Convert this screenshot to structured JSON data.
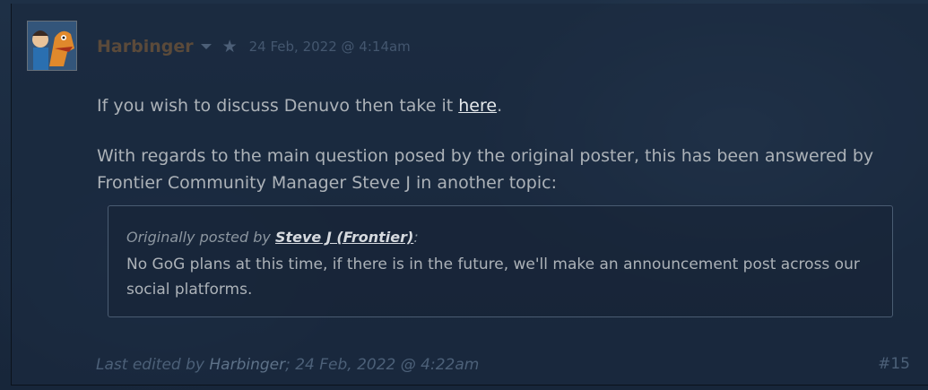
{
  "post": {
    "author": "Harbinger",
    "timestamp": "24 Feb, 2022 @ 4:14am",
    "paragraph1_prefix": "If you wish to discuss Denuvo then take it ",
    "paragraph1_link": "here",
    "paragraph1_suffix": ".",
    "paragraph2": "With regards to the main question posed by the original poster, this has been answered by Frontier Community Manager Steve J in another topic:",
    "quote": {
      "prefix": "Originally posted by ",
      "author": "Steve J (Frontier)",
      "suffix": ":",
      "text": "No GoG plans at this time, if there is in the future, we'll make an announcement post across our social platforms."
    },
    "edited_prefix": "Last edited by ",
    "edited_by": "Harbinger",
    "edited_suffix": "; 24 Feb, 2022 @ 4:22am",
    "post_number": "#15"
  },
  "icons": {
    "author_menu": "chevron-down-icon",
    "favorite": "star-icon"
  },
  "colors": {
    "background": "#1b2838",
    "author_name": "#5b4a3a",
    "body_text": "#acb2b8",
    "link": "#e5e9ec",
    "muted": "#4c6078"
  }
}
